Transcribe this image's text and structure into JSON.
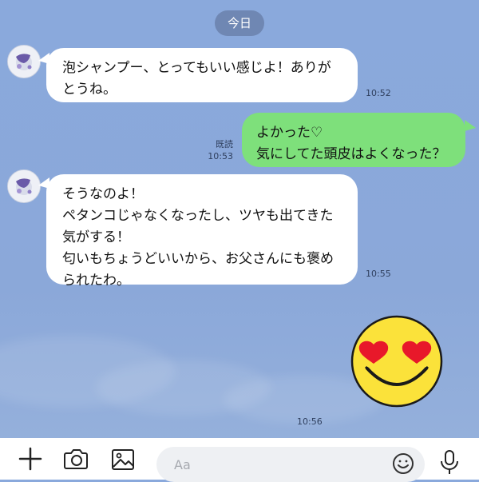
{
  "date_divider": "今日",
  "messages": [
    {
      "side": "in",
      "text": "泡シャンプー、とってもいい感じよ！ありが\nとうね。",
      "time": "10:52"
    },
    {
      "side": "out",
      "text": "よかった♡\n気にしてた頭皮はよくなった？",
      "time": "10:53",
      "read": "既読"
    },
    {
      "side": "in",
      "text": "そうなのよ！\nペタンコじゃなくなったし、ツヤも出てきた\n気がする！\n匂いもちょうどいいから、お父さんにも褒め\nられたわ。",
      "time": "10:55"
    },
    {
      "side": "out",
      "sticker": "heart-eyes-smiley",
      "time": "10:56"
    }
  ],
  "input": {
    "placeholder": "Aa"
  },
  "icons": {
    "add": "plus-icon",
    "camera": "camera-icon",
    "gallery": "image-icon",
    "emoji": "smiley-icon",
    "voice": "microphone-icon"
  },
  "colors": {
    "background": "#8aa9dc",
    "out_bubble": "#7ee07b",
    "in_bubble": "#ffffff",
    "date_pill": "#6f87b3"
  }
}
